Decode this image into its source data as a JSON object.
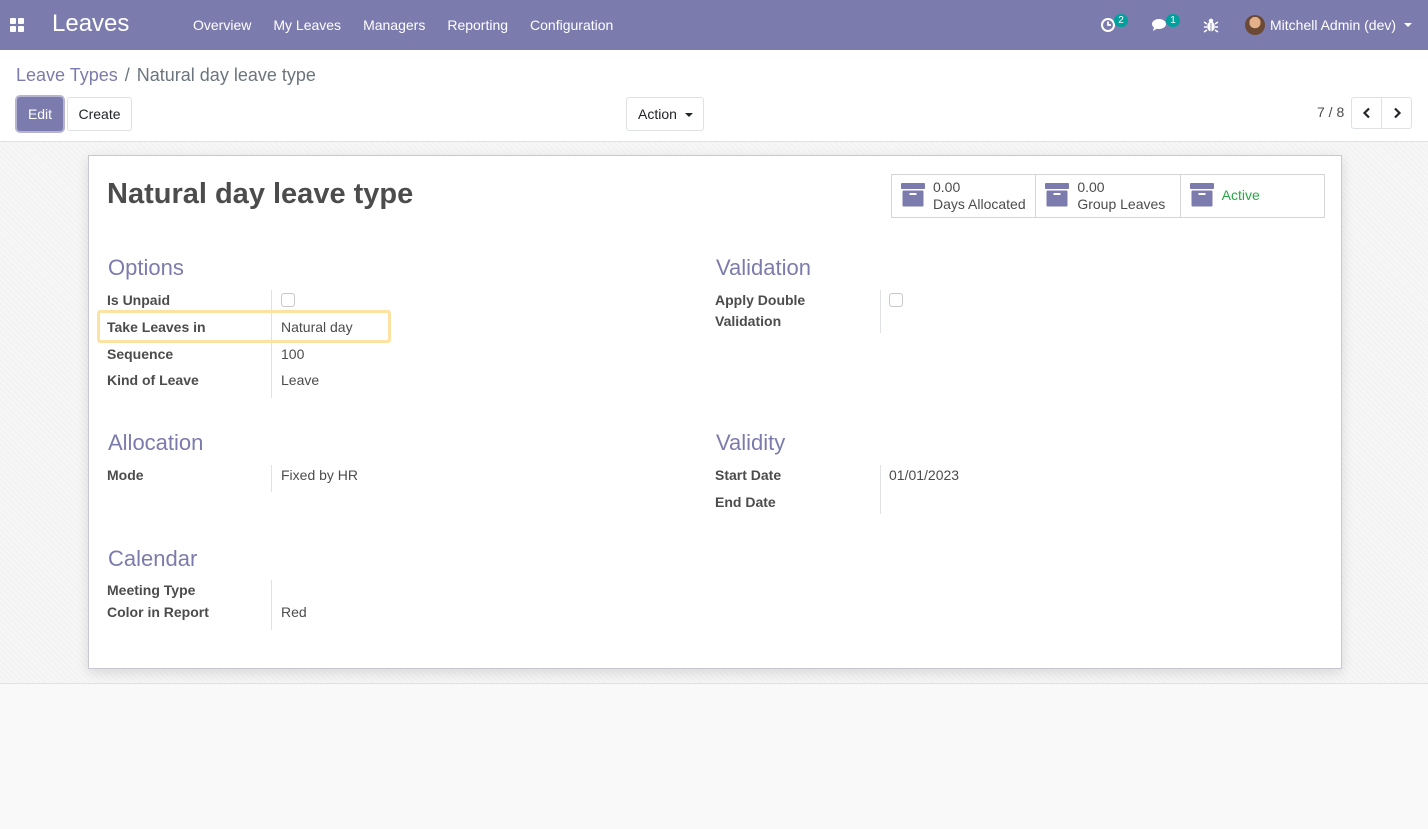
{
  "navbar": {
    "app_title": "Leaves",
    "menu": [
      "Overview",
      "My Leaves",
      "Managers",
      "Reporting",
      "Configuration"
    ],
    "activity_badge": "2",
    "messages_badge": "1",
    "user_name": "Mitchell Admin (dev)",
    "color": "#7c7bad"
  },
  "breadcrumb": {
    "parent": "Leave Types",
    "separator": "/",
    "current": "Natural day leave type"
  },
  "buttons": {
    "edit": "Edit",
    "create": "Create",
    "action": "Action"
  },
  "pager": {
    "value": "7 / 8"
  },
  "record": {
    "title": "Natural day leave type",
    "stat_buttons": [
      {
        "value": "0.00",
        "label": "Days Allocated",
        "icon": "archive-box-icon"
      },
      {
        "value": "0.00",
        "label": "Group Leaves",
        "icon": "archive-box-icon"
      },
      {
        "label": "Active",
        "icon": "archive-box-icon",
        "color": "#28a745"
      }
    ]
  },
  "options": {
    "title": "Options",
    "is_unpaid_label": "Is Unpaid",
    "is_unpaid_checked": false,
    "take_leaves_in_label": "Take Leaves in",
    "take_leaves_in_value": "Natural day",
    "sequence_label": "Sequence",
    "sequence_value": "100",
    "kind_of_leave_label": "Kind of Leave",
    "kind_of_leave_value": "Leave"
  },
  "validation": {
    "title": "Validation",
    "apply_double_validation_label_line1": "Apply Double",
    "apply_double_validation_label_line2": "Validation",
    "apply_double_validation_checked": false
  },
  "allocation": {
    "title": "Allocation",
    "mode_label": "Mode",
    "mode_value": "Fixed by HR"
  },
  "validity": {
    "title": "Validity",
    "start_date_label": "Start Date",
    "start_date_value": "01/01/2023",
    "end_date_label": "End Date",
    "end_date_value": ""
  },
  "calendar": {
    "title": "Calendar",
    "meeting_type_label": "Meeting Type",
    "meeting_type_value": "",
    "color_in_report_label": "Color in Report",
    "color_in_report_value": "Red"
  }
}
